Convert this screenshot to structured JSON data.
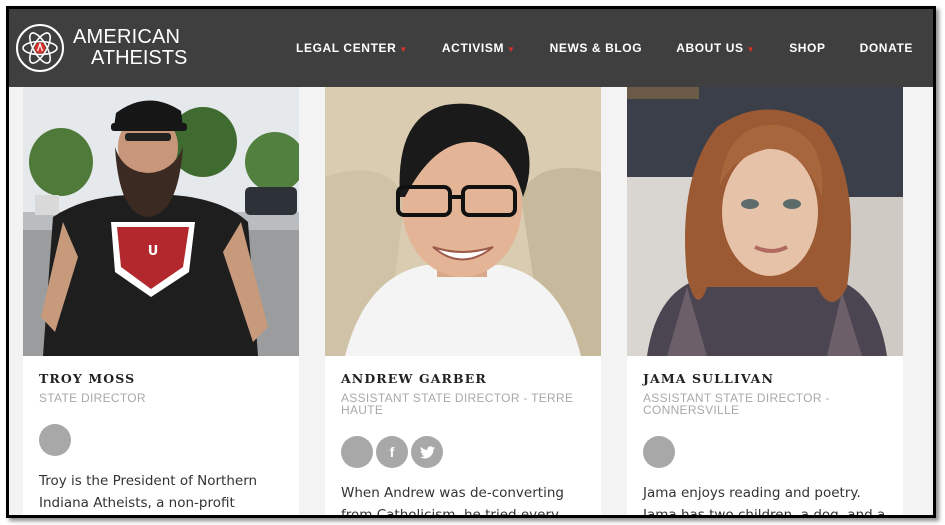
{
  "brand": {
    "line1": "AMERICAN",
    "line2": "ATHEISTS"
  },
  "nav": {
    "items": [
      {
        "label": "LEGAL CENTER",
        "dropdown": true
      },
      {
        "label": "ACTIVISM",
        "dropdown": true
      },
      {
        "label": "NEWS & BLOG",
        "dropdown": false
      },
      {
        "label": "ABOUT US",
        "dropdown": true
      },
      {
        "label": "SHOP",
        "dropdown": false
      },
      {
        "label": "DONATE",
        "dropdown": false
      }
    ],
    "caret": "▼"
  },
  "colors": {
    "header_bg": "#3f3f3f",
    "accent": "#d6322b",
    "social_bg": "#a8a8a8"
  },
  "people": [
    {
      "name": "TROY MOSS",
      "role": "STATE DIRECTOR",
      "socials": [
        "generic"
      ],
      "bio": "Troy is the President of Northern Indiana Atheists, a non-profit"
    },
    {
      "name": "ANDREW GARBER",
      "role": "ASSISTANT STATE DIRECTOR - TERRE HAUTE",
      "socials": [
        "generic",
        "facebook",
        "twitter"
      ],
      "social_glyphs": {
        "facebook": "f",
        "twitter": "🐦"
      },
      "bio": "When Andrew was de-converting from Catholicism, he tried every"
    },
    {
      "name": "JAMA SULLIVAN",
      "role": "ASSISTANT STATE DIRECTOR - CONNERSVILLE",
      "socials": [
        "generic"
      ],
      "bio": "Jama enjoys reading and poetry. Jama has two children, a dog, and a cat"
    }
  ]
}
